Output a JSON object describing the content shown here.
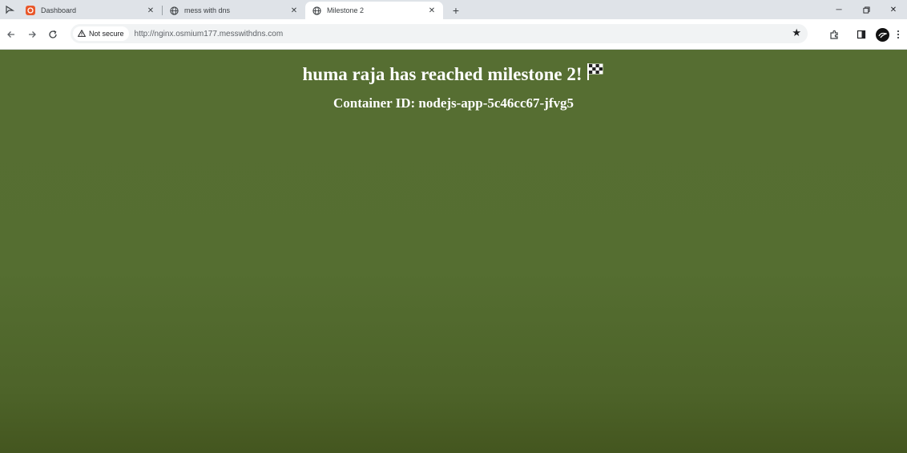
{
  "tabs": [
    {
      "title": "Dashboard",
      "icon": "ubuntu-logo-icon",
      "active": false
    },
    {
      "title": "mess with dns",
      "icon": "globe-icon",
      "active": false
    },
    {
      "title": "Milestone 2",
      "icon": "globe-icon",
      "active": true
    }
  ],
  "toolbar": {
    "security_label": "Not secure",
    "url": "http://nginx.osmium177.messwithdns.com"
  },
  "page": {
    "heading": "huma raja has reached milestone 2!",
    "subheading": "Container ID: nodejs-app-5c46cc67-jfvg5"
  },
  "colors": {
    "page_background": "#566e32",
    "tab_strip": "#dfe3e8",
    "dashboard_favicon": "#e9572a"
  }
}
